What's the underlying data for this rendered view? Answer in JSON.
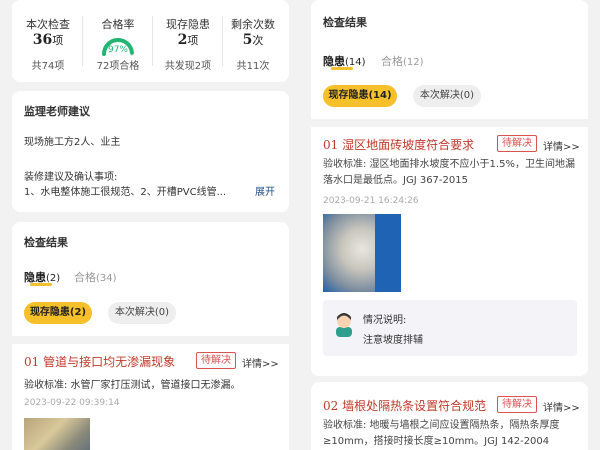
{
  "stats": [
    {
      "label": "本次检查",
      "value": "36",
      "unit": "项",
      "sub": "共74项"
    },
    {
      "label": "合格率",
      "value": "97%",
      "unit": "",
      "sub": "72项合格",
      "ratio": 0.97
    },
    {
      "label": "现存隐患",
      "value": "2",
      "unit": "项",
      "sub": "共发现2项"
    },
    {
      "label": "剩余次数",
      "value": "5",
      "unit": "次",
      "sub": "共11次"
    }
  ],
  "advice": {
    "title": "监理老师建议",
    "members": "现场施工方2人、业主",
    "items_label": "装修建议及确认事项:",
    "items_text": "1、水电整体施工很规范、2、开槽PVC线管...",
    "expand": "展开"
  },
  "left_results": {
    "title": "检查结果",
    "tab_hazard": "隐患",
    "tab_hazard_count": "(2)",
    "tab_pass": "合格",
    "tab_pass_count": "(34)",
    "filter_current": "现存隐患(2)",
    "filter_solved": "本次解决(0)",
    "item": {
      "title": "01 管道与接口均无渗漏现象",
      "status": "待解决",
      "detail": "详情>>",
      "standard": "验收标准:  水管厂家打压测试，管道接口无渗漏。",
      "time": "2023-09-22 09:39:14"
    }
  },
  "right_results": {
    "title": "检查结果",
    "tab_hazard": "隐患",
    "tab_hazard_count": "(14)",
    "tab_pass": "合格",
    "tab_pass_count": "(12)",
    "filter_current": "现存隐患(14)",
    "filter_solved": "本次解决(0)",
    "item1": {
      "title": "01 湿区地面砖坡度符合要求",
      "status": "待解决",
      "detail": "详情>>",
      "standard": "验收标准:  湿区地面排水坡度不应小于1.5%，卫生间地漏落水口是最低点。JGJ 367-2015",
      "time": "2023-09-21 16:24:26",
      "note_label": "情况说明:",
      "note_text": "注意坡度排辅"
    },
    "item2": {
      "title": "02 墙根处隔热条设置符合规范",
      "status": "待解决",
      "detail": "详情>>",
      "standard": "验收标准:  地暖与墙根之间应设置隔热条，隔热条厚度≥10mm，搭接时接长度≥10mm。JGJ 142-2004"
    }
  },
  "colors": {
    "accent": "#f5c02a",
    "danger": "#c0392b",
    "gauge": "#22b573"
  }
}
